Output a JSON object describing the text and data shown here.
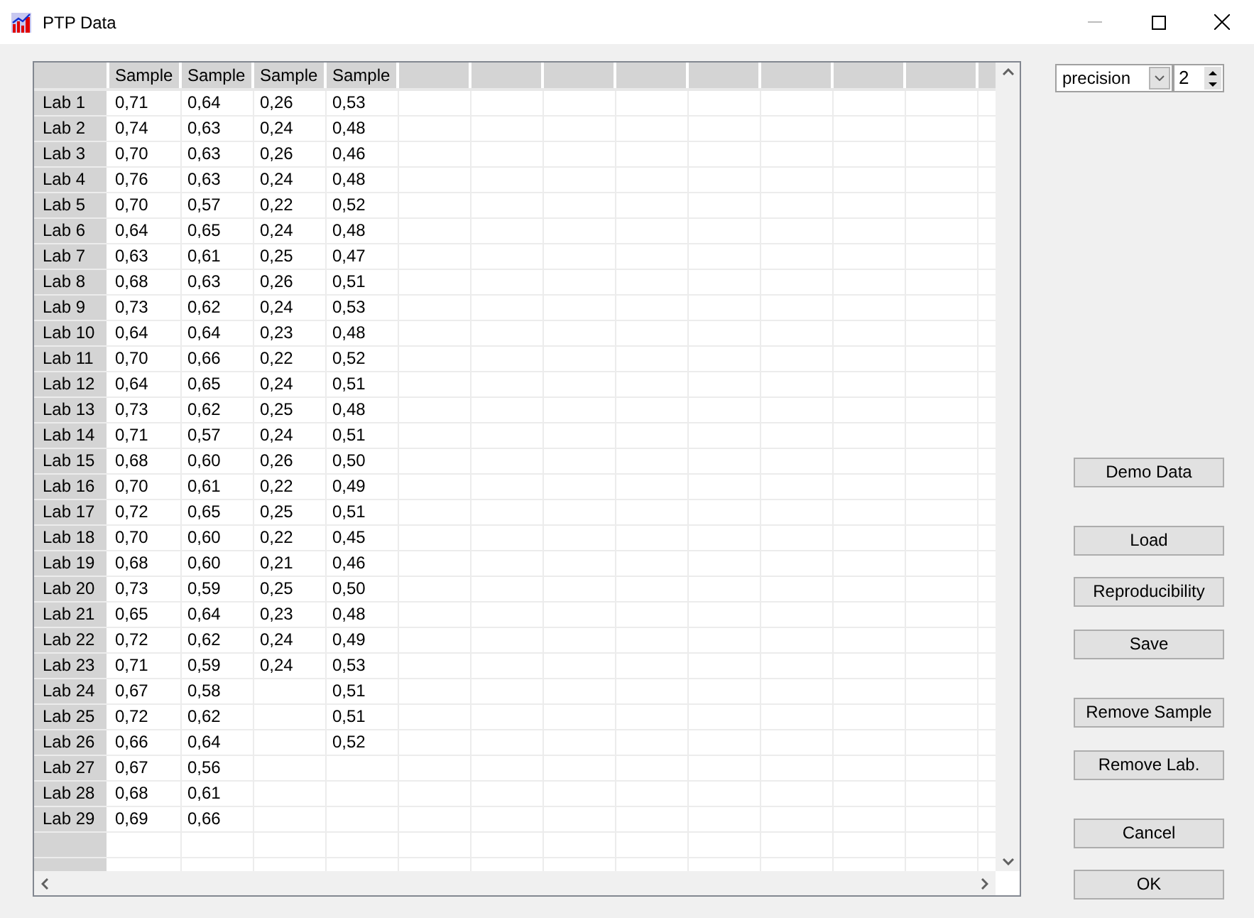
{
  "window": {
    "title": "PTP Data"
  },
  "table": {
    "columns": [
      "Sample",
      "Sample",
      "Sample",
      "Sample"
    ],
    "rows": [
      {
        "label": "Lab 1",
        "cells": [
          "0,71",
          "0,64",
          "0,26",
          "0,53"
        ]
      },
      {
        "label": "Lab 2",
        "cells": [
          "0,74",
          "0,63",
          "0,24",
          "0,48"
        ]
      },
      {
        "label": "Lab 3",
        "cells": [
          "0,70",
          "0,63",
          "0,26",
          "0,46"
        ]
      },
      {
        "label": "Lab 4",
        "cells": [
          "0,76",
          "0,63",
          "0,24",
          "0,48"
        ]
      },
      {
        "label": "Lab 5",
        "cells": [
          "0,70",
          "0,57",
          "0,22",
          "0,52"
        ]
      },
      {
        "label": "Lab 6",
        "cells": [
          "0,64",
          "0,65",
          "0,24",
          "0,48"
        ]
      },
      {
        "label": "Lab 7",
        "cells": [
          "0,63",
          "0,61",
          "0,25",
          "0,47"
        ]
      },
      {
        "label": "Lab 8",
        "cells": [
          "0,68",
          "0,63",
          "0,26",
          "0,51"
        ]
      },
      {
        "label": "Lab 9",
        "cells": [
          "0,73",
          "0,62",
          "0,24",
          "0,53"
        ]
      },
      {
        "label": "Lab 10",
        "cells": [
          "0,64",
          "0,64",
          "0,23",
          "0,48"
        ]
      },
      {
        "label": "Lab 11",
        "cells": [
          "0,70",
          "0,66",
          "0,22",
          "0,52"
        ]
      },
      {
        "label": "Lab 12",
        "cells": [
          "0,64",
          "0,65",
          "0,24",
          "0,51"
        ]
      },
      {
        "label": "Lab 13",
        "cells": [
          "0,73",
          "0,62",
          "0,25",
          "0,48"
        ]
      },
      {
        "label": "Lab 14",
        "cells": [
          "0,71",
          "0,57",
          "0,24",
          "0,51"
        ]
      },
      {
        "label": "Lab 15",
        "cells": [
          "0,68",
          "0,60",
          "0,26",
          "0,50"
        ]
      },
      {
        "label": "Lab 16",
        "cells": [
          "0,70",
          "0,61",
          "0,22",
          "0,49"
        ]
      },
      {
        "label": "Lab 17",
        "cells": [
          "0,72",
          "0,65",
          "0,25",
          "0,51"
        ]
      },
      {
        "label": "Lab 18",
        "cells": [
          "0,70",
          "0,60",
          "0,22",
          "0,45"
        ]
      },
      {
        "label": "Lab 19",
        "cells": [
          "0,68",
          "0,60",
          "0,21",
          "0,46"
        ]
      },
      {
        "label": "Lab 20",
        "cells": [
          "0,73",
          "0,59",
          "0,25",
          "0,50"
        ]
      },
      {
        "label": "Lab 21",
        "cells": [
          "0,65",
          "0,64",
          "0,23",
          "0,48"
        ]
      },
      {
        "label": "Lab 22",
        "cells": [
          "0,72",
          "0,62",
          "0,24",
          "0,49"
        ]
      },
      {
        "label": "Lab 23",
        "cells": [
          "0,71",
          "0,59",
          "0,24",
          "0,53"
        ]
      },
      {
        "label": "Lab 24",
        "cells": [
          "0,67",
          "0,58",
          null,
          "0,51"
        ]
      },
      {
        "label": "Lab 25",
        "cells": [
          "0,72",
          "0,62",
          null,
          "0,51"
        ]
      },
      {
        "label": "Lab 26",
        "cells": [
          "0,66",
          "0,64",
          null,
          "0,52"
        ]
      },
      {
        "label": "Lab 27",
        "cells": [
          "0,67",
          "0,56",
          null,
          null
        ]
      },
      {
        "label": "Lab 28",
        "cells": [
          "0,68",
          "0,61",
          null,
          null
        ]
      },
      {
        "label": "Lab 29",
        "cells": [
          "0,69",
          "0,66",
          null,
          null
        ]
      }
    ]
  },
  "precision": {
    "mode": "precision",
    "digits": "2"
  },
  "buttons": [
    {
      "label": "Demo Data"
    },
    {
      "label": "Load"
    },
    {
      "label": "Reproducibility"
    },
    {
      "label": "Save"
    },
    {
      "label": "Remove Sample"
    },
    {
      "label": "Remove Lab."
    },
    {
      "label": "Cancel"
    },
    {
      "label": "OK"
    }
  ]
}
